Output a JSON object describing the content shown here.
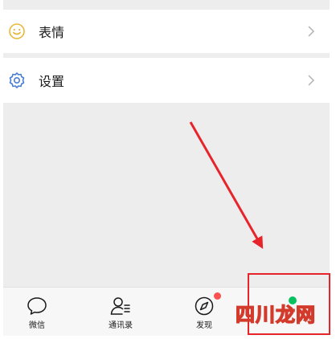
{
  "menu": {
    "emoji_label": "表情",
    "settings_label": "设置"
  },
  "tabbar": {
    "chats": "微信",
    "contacts": "通讯录",
    "discover": "发现",
    "me": ""
  },
  "watermark": "四川龙网",
  "colors": {
    "accent_green": "#07c160",
    "badge_red": "#fa5151",
    "annotation_red": "#e8242b",
    "icon_blue": "#4a7fd4",
    "icon_yellow": "#e8b83a"
  }
}
